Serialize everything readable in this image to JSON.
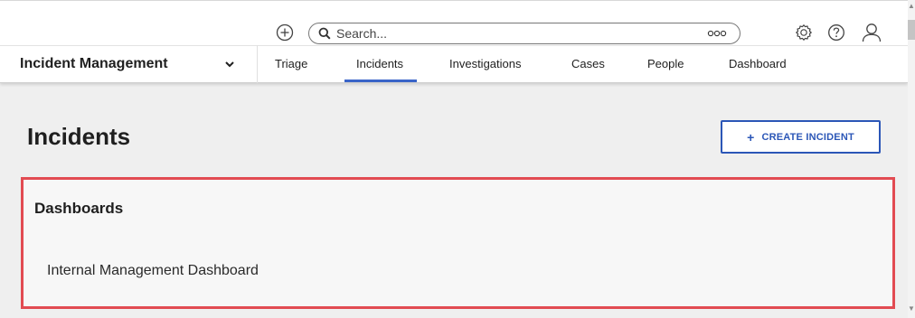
{
  "header": {
    "search_placeholder": "Search..."
  },
  "nav": {
    "app_title": "Incident Management",
    "tabs": [
      {
        "label": "Triage"
      },
      {
        "label": "Incidents"
      },
      {
        "label": "Investigations"
      },
      {
        "label": "Cases"
      },
      {
        "label": "People"
      },
      {
        "label": "Dashboard"
      }
    ],
    "active_tab": "Incidents"
  },
  "page": {
    "title": "Incidents",
    "create_button": "CREATE INCIDENT"
  },
  "dashboards": {
    "title": "Dashboards",
    "items": [
      "Internal Management Dashboard"
    ]
  },
  "colors": {
    "accent": "#2b56b7",
    "highlight_border": "#e24b52"
  },
  "icons": {
    "add": "plus-circle-icon",
    "search": "search-icon",
    "more": "ellipsis-icon",
    "settings": "gear-icon",
    "help": "help-icon",
    "user": "user-icon",
    "dropdown": "chevron-down-icon",
    "create": "plus-icon"
  }
}
